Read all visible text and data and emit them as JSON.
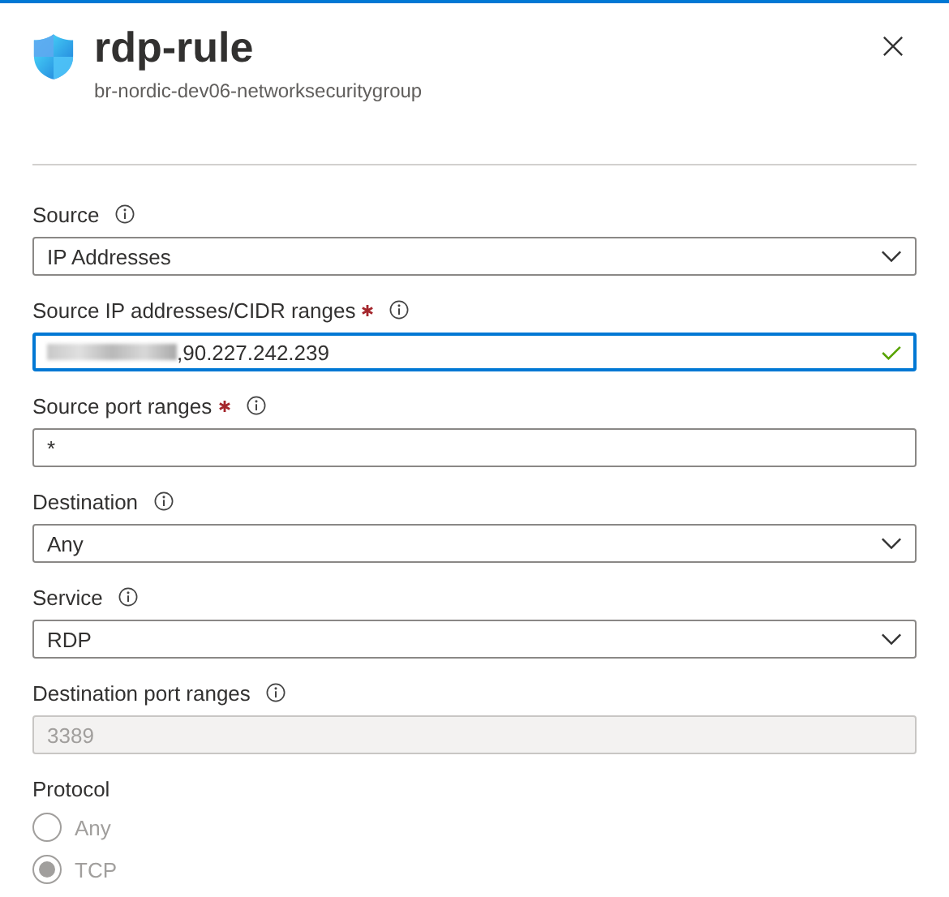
{
  "header": {
    "title": "rdp-rule",
    "subtitle": "br-nordic-dev06-networksecuritygroup"
  },
  "fields": [
    {
      "kind": "dropdown",
      "label": "Source",
      "required": false,
      "info": true,
      "value": "IP Addresses",
      "disabled": false
    },
    {
      "kind": "text",
      "label": "Source IP addresses/CIDR ranges",
      "required": true,
      "info": true,
      "redacted": true,
      "value": ",90.227.242.239",
      "focused": true,
      "valid": true,
      "disabled": false
    },
    {
      "kind": "text",
      "label": "Source port ranges",
      "required": true,
      "info": true,
      "value": "*",
      "focused": false,
      "valid": false,
      "disabled": false
    },
    {
      "kind": "dropdown",
      "label": "Destination",
      "required": false,
      "info": true,
      "value": "Any",
      "disabled": false
    },
    {
      "kind": "dropdown",
      "label": "Service",
      "required": false,
      "info": true,
      "value": "RDP",
      "disabled": false
    },
    {
      "kind": "text",
      "label": "Destination port ranges",
      "required": false,
      "info": true,
      "value": "3389",
      "focused": false,
      "valid": false,
      "disabled": true
    },
    {
      "kind": "radio",
      "label": "Protocol",
      "required": false,
      "info": false,
      "disabled": true,
      "options": [
        {
          "label": "Any",
          "selected": false
        },
        {
          "label": "TCP",
          "selected": true
        }
      ]
    }
  ]
}
